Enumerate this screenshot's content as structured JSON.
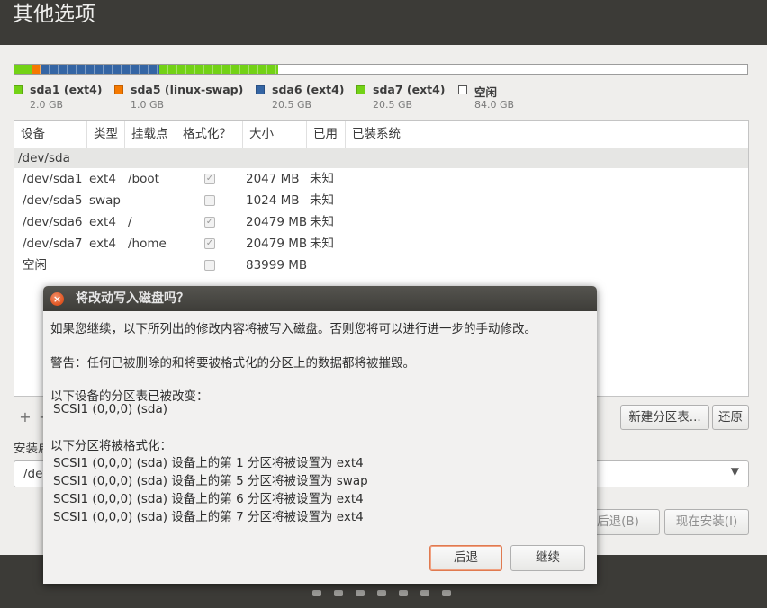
{
  "page": {
    "title": "其他选项"
  },
  "partition_bar": [
    {
      "name": "sda1 (ext4)",
      "size": "2.0 GB",
      "color": "#73d216",
      "fraction": 0.0238
    },
    {
      "name": "sda5 (linux-swap)",
      "size": "1.0 GB",
      "color": "#f57900",
      "fraction": 0.0119
    },
    {
      "name": "sda6 (ext4)",
      "size": "20.5 GB",
      "color": "#3465a4",
      "fraction": 0.1619
    },
    {
      "name": "sda7 (ext4)",
      "size": "20.5 GB",
      "color": "#73d216",
      "fraction": 0.1619
    },
    {
      "name": "空闲",
      "size": "84.0 GB",
      "color": "#ffffff",
      "fraction": 0.6405
    }
  ],
  "table": {
    "headers": [
      "设备",
      "类型",
      "挂载点",
      "格式化？",
      "大小",
      "已用",
      "已装系统"
    ],
    "group": "/dev/sda",
    "rows": [
      {
        "device": "/dev/sda1",
        "type": "ext4",
        "mount": "/boot",
        "format": true,
        "size": "2047 MB",
        "used": "未知"
      },
      {
        "device": "/dev/sda5",
        "type": "swap",
        "mount": "",
        "format": false,
        "size": "1024 MB",
        "used": "未知"
      },
      {
        "device": "/dev/sda6",
        "type": "ext4",
        "mount": "/",
        "format": true,
        "size": "20479 MB",
        "used": "未知"
      },
      {
        "device": "/dev/sda7",
        "type": "ext4",
        "mount": "/home",
        "format": true,
        "size": "20479 MB",
        "used": "未知"
      },
      {
        "device": "空闲",
        "type": "",
        "mount": "",
        "format": false,
        "size": "83999 MB",
        "used": ""
      }
    ]
  },
  "toolbar": {
    "add": "+",
    "remove": "−",
    "new_table": "新建分区表...",
    "revert": "还原"
  },
  "bootloader": {
    "label": "安装启动引导器的设备：",
    "value": "/dev/sda"
  },
  "nav": {
    "back": "后退(B)",
    "install": "现在安装(I)"
  },
  "dialog": {
    "title": "将改动写入磁盘吗？",
    "intro": "如果您继续，以下所列出的修改内容将被写入磁盘。否则您将可以进行进一步的手动修改。",
    "warning": "警告：任何已被删除的和将要被格式化的分区上的数据都将被摧毁。",
    "table_heading": "以下设备的分区表已被改变：",
    "table_device": "SCSI1 (0,0,0) (sda)",
    "format_heading": "以下分区将被格式化：",
    "format_lines": [
      "SCSI1 (0,0,0) (sda) 设备上的第 1 分区将被设置为 ext4",
      "SCSI1 (0,0,0) (sda) 设备上的第 5 分区将被设置为 swap",
      "SCSI1 (0,0,0) (sda) 设备上的第 6 分区将被设置为 ext4",
      "SCSI1 (0,0,0) (sda) 设备上的第 7 分区将被设置为 ext4"
    ],
    "back_button": "后退",
    "continue_button": "继续"
  },
  "progress_dots": 7
}
